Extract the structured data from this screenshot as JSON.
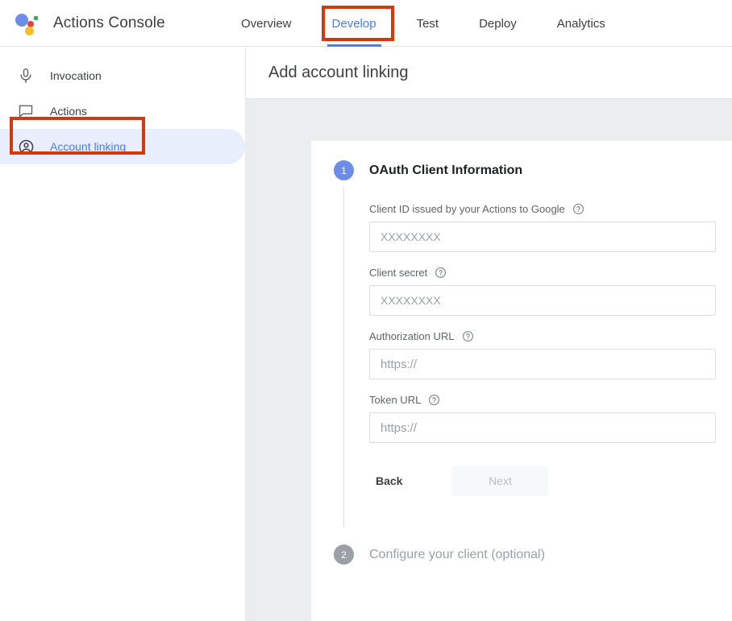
{
  "colors": {
    "accent_blue": "#4a7cf2",
    "badge_blue": "#6b8de8",
    "badge_gray": "#9aa0a6",
    "annotation_red": "#d4380d",
    "selected_pill": "#e8eefc",
    "content_gray": "#ecedef"
  },
  "topbar": {
    "logo_name": "google-assistant-logo",
    "brand_title": "Actions Console",
    "tabs": [
      {
        "label": "Overview",
        "active": false
      },
      {
        "label": "Develop",
        "active": true
      },
      {
        "label": "Test",
        "active": false
      },
      {
        "label": "Deploy",
        "active": false
      },
      {
        "label": "Analytics",
        "active": false
      }
    ]
  },
  "sidebar": {
    "items": [
      {
        "label": "Invocation",
        "icon": "microphone-icon",
        "selected": false
      },
      {
        "label": "Actions",
        "icon": "chat-bubble-icon",
        "selected": false
      },
      {
        "label": "Account linking",
        "icon": "account-circle-icon",
        "selected": true
      }
    ]
  },
  "main": {
    "page_title": "Add account linking",
    "steps": [
      {
        "number": "1",
        "title": "OAuth Client Information",
        "active": true,
        "fields": [
          {
            "label": "Client ID issued by your Actions to Google",
            "help": "help-icon",
            "value": "",
            "placeholder": "XXXXXXXX",
            "type": "text"
          },
          {
            "label": "Client secret",
            "help": "help-icon",
            "value": "",
            "placeholder": "XXXXXXXX",
            "type": "text"
          },
          {
            "label": "Authorization URL",
            "help": "help-icon",
            "value": "",
            "placeholder": "https://",
            "type": "url"
          },
          {
            "label": "Token URL",
            "help": "help-icon",
            "value": "",
            "placeholder": "https://",
            "type": "url"
          }
        ],
        "buttons": {
          "back_label": "Back",
          "next_label": "Next",
          "next_disabled": true
        }
      },
      {
        "number": "2",
        "title": "Configure your client (optional)",
        "active": false
      }
    ]
  },
  "annotations": [
    {
      "name": "develop-tab-highlight",
      "target": "Develop"
    },
    {
      "name": "account-linking-highlight",
      "target": "Account linking"
    }
  ]
}
